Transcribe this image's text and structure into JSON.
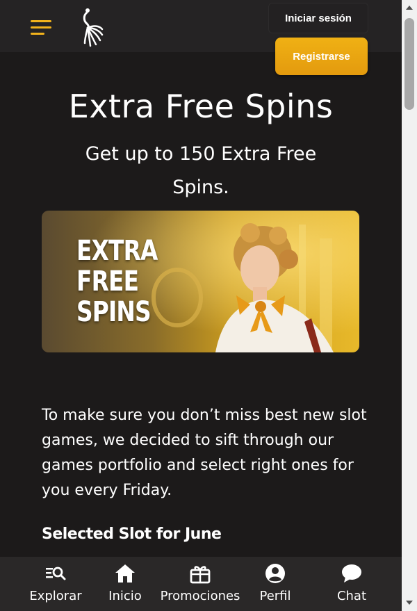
{
  "header": {
    "menu_icon": "hamburger-menu-icon",
    "logo_icon": "peacock-logo-icon",
    "login_label": "Iniciar sesión",
    "register_label": "Registrarse",
    "accent_color": "#f2b21c"
  },
  "main": {
    "title": "Extra Free Spins",
    "subtitle": "Get up to 150 Extra Free Spins.",
    "banner": {
      "text": "EXTRA\nFREE\nSPINS"
    },
    "intro": "To make sure you don’t miss best new slot games, we decided to sift through our games portfolio and select right ones for you every Friday.",
    "section_heading": "Selected Slot for June"
  },
  "bottom_nav": {
    "items": [
      {
        "label": "Explorar",
        "icon": "search-list-icon"
      },
      {
        "label": "Inicio",
        "icon": "home-icon"
      },
      {
        "label": "Promociones",
        "icon": "gift-icon"
      },
      {
        "label": "Perfil",
        "icon": "user-icon"
      },
      {
        "label": "Chat",
        "icon": "chat-bubble-icon"
      }
    ]
  }
}
